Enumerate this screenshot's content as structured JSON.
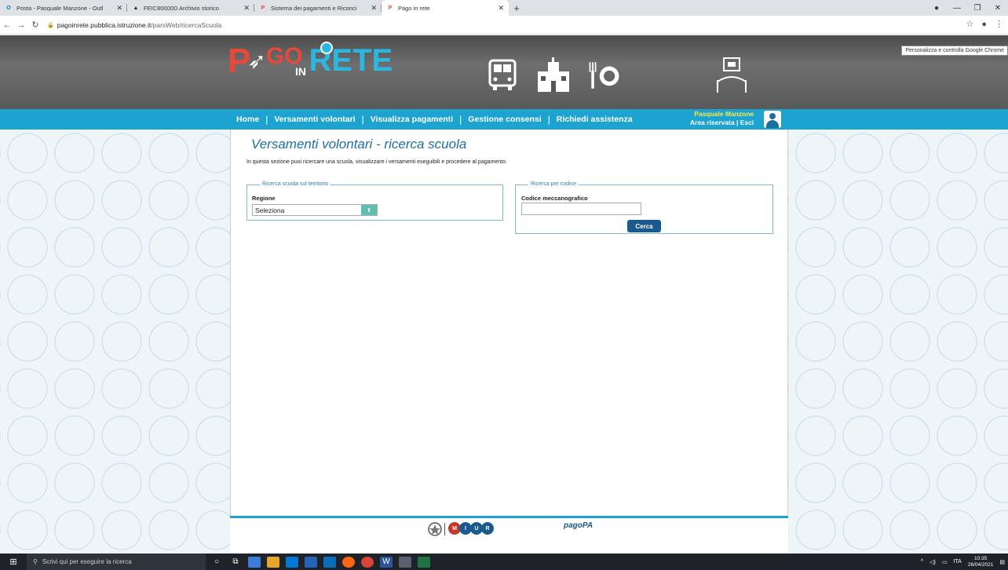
{
  "browser": {
    "tabs": [
      {
        "label": "Posta - Pasquale Manzone - Outl",
        "favicon": "O",
        "color": "#0a6ebd",
        "active": false
      },
      {
        "label": "FEIC80000D Archivio storico",
        "favicon": "▲",
        "color": "#222",
        "active": false
      },
      {
        "label": "Sistema dei pagamenti e Riconci",
        "favicon": "P",
        "color": "#e8483a",
        "active": false
      },
      {
        "label": "Pago in rete",
        "favicon": "P",
        "color": "#e8483a",
        "active": true
      }
    ],
    "url_domain": "pagoinrete.pubblica.istruzione.it",
    "url_path": "/parsWeb/ricercaScuola",
    "tooltip": "Personalizza e controlla Google Chrome"
  },
  "logo": {
    "p": "P",
    "go": "GO",
    "in": "IN",
    "rete": "RETE"
  },
  "nav": {
    "items": [
      "Home",
      "Versamenti volontari",
      "Visualizza pagamenti",
      "Gestione consensi",
      "Richiedi assistenza"
    ],
    "user_name": "Pasquale Manzone",
    "area": "Area riservata | Esci"
  },
  "main": {
    "title": "Versamenti volontari - ricerca scuola",
    "intro": "In questa sezione puoi ricercare una scuola, visualizzare i versamenti eseguibili e procedere al pagamento.",
    "territorio": {
      "legend": "Ricerca scuola sul territorio",
      "label": "Regione",
      "value": "Seleziona"
    },
    "codice": {
      "legend": "Ricerca per codice",
      "label": "Codice meccanografico",
      "value": "",
      "button": "Cerca"
    }
  },
  "footer": {
    "miur": "MIUR",
    "pagopa": "pagoPA"
  },
  "taskbar": {
    "search_placeholder": "Scrivi qui per eseguire la ricerca",
    "lang": "ITA",
    "time": "10:35",
    "date": "26/04/2021"
  },
  "colors": {
    "nav": "#1ca3d0",
    "title": "#1c6ea8",
    "button": "#1a5a8f"
  }
}
